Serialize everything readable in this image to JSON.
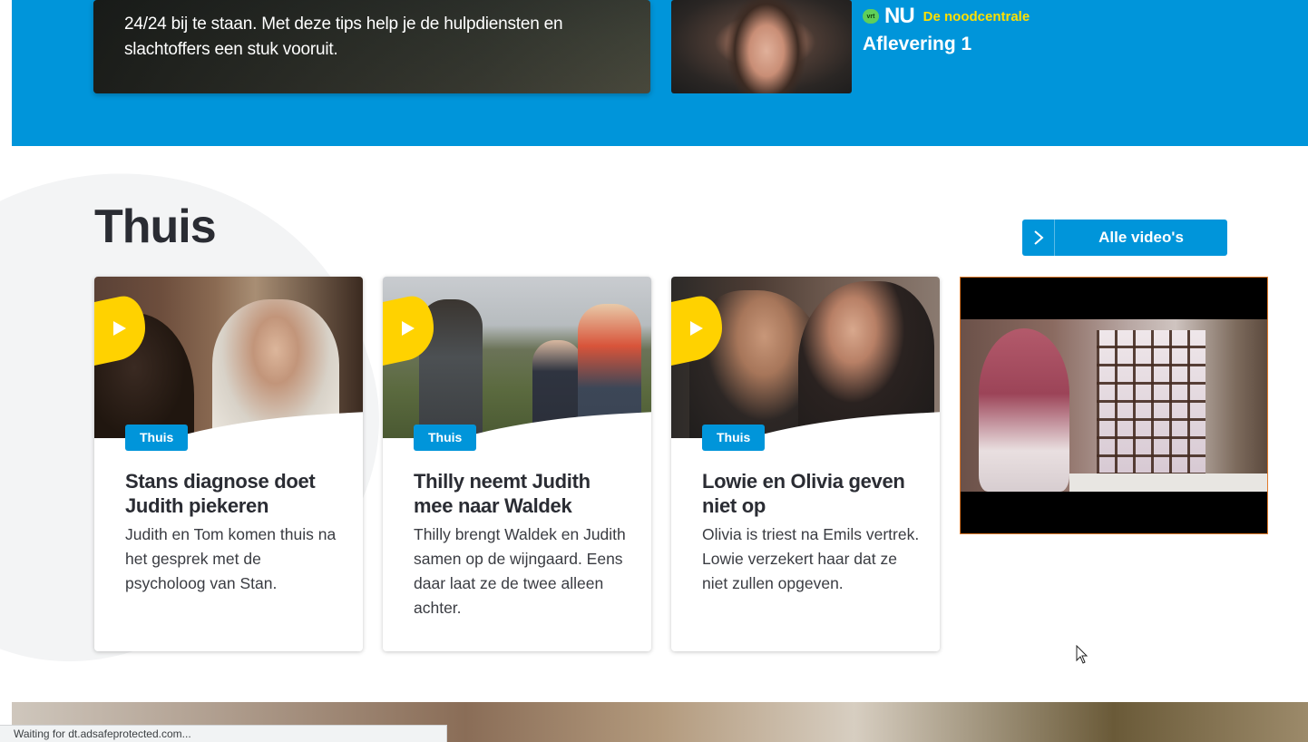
{
  "top_banner": {
    "description_text": "24/24 bij te staan. Met deze tips help je de hulpdiensten en slachtoffers een stuk vooruit.",
    "brand_badge": "vrt",
    "brand_mark": "NU",
    "show_name": "De noodcentrale",
    "episode": "Aflevering 1"
  },
  "section": {
    "title": "Thuis",
    "all_videos_label": "Alle video's"
  },
  "cards": [
    {
      "tag": "Thuis",
      "title": "Stans diagnose doet Judith piekeren",
      "description": "Judith en Tom komen thuis na het gesprek met de psycholoog van Stan."
    },
    {
      "tag": "Thuis",
      "title": "Thilly neemt Judith mee naar Waldek",
      "description": "Thilly brengt Waldek en Judith samen op de wijngaard. Eens daar laat ze de twee alleen achter."
    },
    {
      "tag": "Thuis",
      "title": "Lowie en Olivia geven niet op",
      "description": "Olivia is triest na Emils vertrek. Lowie verzekert haar dat ze niet zullen opgeven."
    }
  ],
  "status_bar": {
    "text": "Waiting for dt.adsafeprotected.com..."
  },
  "colors": {
    "brand_blue": "#0095da",
    "play_yellow": "#ffd200",
    "show_name_yellow": "#ffe000",
    "vrt_green": "#5fcf5a",
    "heading_dark": "#2a2c33"
  },
  "icons": {
    "play": "play-icon",
    "chevron": "chevron-right-icon",
    "cursor": "mouse-pointer-icon"
  }
}
